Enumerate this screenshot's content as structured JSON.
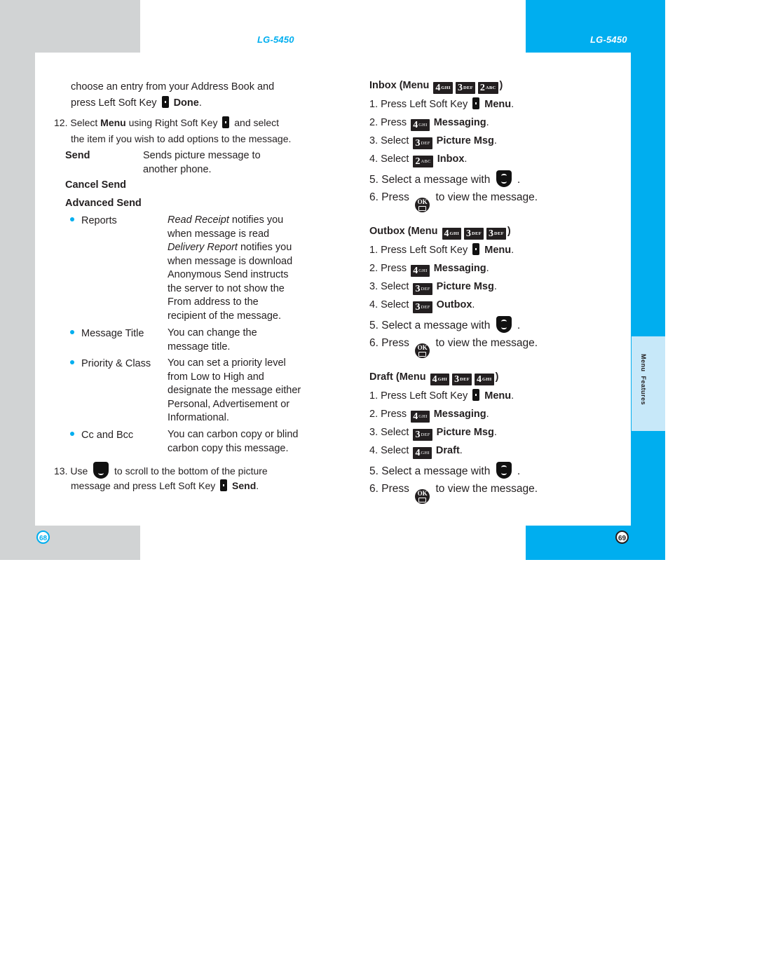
{
  "colors": {
    "accent_blue": "#00aeef",
    "light_blue": "#c7e8f9",
    "gray_frame": "#d1d3d4",
    "text": "#231f20"
  },
  "left_page": {
    "model": "LG-5450",
    "page_number": "68",
    "intro": {
      "line1": "choose an entry from your Address Book and",
      "line2_pre": "press Left Soft Key",
      "line2_bold": "Done",
      "line2_post": "."
    },
    "step12": {
      "num": "12. Select",
      "bold": "Menu",
      "mid": "using Right Soft Key",
      "end": "and select",
      "line2": "the item if you wish to add options to the message."
    },
    "options": [
      {
        "label": "Send",
        "desc_line1": "Sends picture message to",
        "desc_line2": "another phone."
      },
      {
        "label": "Cancel Send"
      },
      {
        "label": "Advanced Send"
      }
    ],
    "advanced_items": [
      {
        "label": "Reports",
        "lines": [
          {
            "italic": "Read Receipt",
            "text": " notifies you"
          },
          {
            "text": "when message is read"
          },
          {
            "italic": "Delivery Report",
            "text": " notifies you"
          },
          {
            "text": "when message is download"
          },
          {
            "text": "Anonymous Send instructs"
          },
          {
            "text": "the server to not show the"
          },
          {
            "text": "From address to the"
          },
          {
            "text": "recipient of the message."
          }
        ]
      },
      {
        "label": "Message Title",
        "lines": [
          {
            "text": "You can change the"
          },
          {
            "text": "message title."
          }
        ]
      },
      {
        "label": "Priority & Class",
        "lines": [
          {
            "text": "You can set a priority level"
          },
          {
            "text": "from Low to High and"
          },
          {
            "text": "designate the message either"
          },
          {
            "text": "Personal, Advertisement or"
          },
          {
            "text": "Informational."
          }
        ]
      },
      {
        "label": "Cc and Bcc",
        "lines": [
          {
            "text": "You can carbon copy or blind"
          },
          {
            "text": "carbon copy this message."
          }
        ]
      }
    ],
    "step13": {
      "num": "13. Use",
      "mid": "to scroll to the bottom of the picture",
      "line2_pre": "message and press Left Soft Key",
      "line2_bold": "Send",
      "line2_post": "."
    }
  },
  "right_page": {
    "model": "LG-5450",
    "page_number": "69",
    "side_tab": {
      "first": "Menu",
      "second": "Features"
    },
    "sections": [
      {
        "title": "Inbox (Menu",
        "keys": [
          {
            "n": "4",
            "l": "GHI"
          },
          {
            "n": "3",
            "l": "DEF"
          },
          {
            "n": "2",
            "l": "ABC"
          }
        ],
        "steps": [
          {
            "pre": "1. Press Left Soft Key",
            "icon": "softkey",
            "bold": "Menu",
            "post": "."
          },
          {
            "pre": "2. Press",
            "key": {
              "n": "4",
              "l": "GHI"
            },
            "bold": "Messaging",
            "post": "."
          },
          {
            "pre": "3. Select",
            "key": {
              "n": "3",
              "l": "DEF"
            },
            "bold": "Picture Msg",
            "post": "."
          },
          {
            "pre": "4. Select",
            "key": {
              "n": "2",
              "l": "ABC"
            },
            "bold": "Inbox",
            "post": "."
          },
          {
            "pre": "5. Select a message with",
            "icon": "nav",
            "post": "."
          },
          {
            "pre": "6. Press",
            "icon": "ok",
            "post": "to view the message."
          }
        ]
      },
      {
        "title": "Outbox (Menu",
        "keys": [
          {
            "n": "4",
            "l": "GHI"
          },
          {
            "n": "3",
            "l": "DEF"
          },
          {
            "n": "3",
            "l": "DEF"
          }
        ],
        "steps": [
          {
            "pre": "1. Press Left Soft Key",
            "icon": "softkey",
            "bold": "Menu",
            "post": "."
          },
          {
            "pre": "2. Press",
            "key": {
              "n": "4",
              "l": "GHI"
            },
            "bold": "Messaging",
            "post": "."
          },
          {
            "pre": "3. Select",
            "key": {
              "n": "3",
              "l": "DEF"
            },
            "bold": "Picture Msg",
            "post": "."
          },
          {
            "pre": "4. Select",
            "key": {
              "n": "3",
              "l": "DEF"
            },
            "bold": "Outbox",
            "post": "."
          },
          {
            "pre": "5. Select a message with",
            "icon": "nav",
            "post": "."
          },
          {
            "pre": "6. Press",
            "icon": "ok",
            "post": "to view the message."
          }
        ]
      },
      {
        "title": "Draft (Menu",
        "keys": [
          {
            "n": "4",
            "l": "GHI"
          },
          {
            "n": "3",
            "l": "DEF"
          },
          {
            "n": "4",
            "l": "GHI"
          }
        ],
        "steps": [
          {
            "pre": "1. Press Left Soft Key",
            "icon": "softkey",
            "bold": "Menu",
            "post": "."
          },
          {
            "pre": "2. Press",
            "key": {
              "n": "4",
              "l": "GHI"
            },
            "bold": "Messaging",
            "post": "."
          },
          {
            "pre": "3. Select",
            "key": {
              "n": "3",
              "l": "DEF"
            },
            "bold": "Picture Msg",
            "post": "."
          },
          {
            "pre": "4. Select",
            "key": {
              "n": "4",
              "l": "GHI"
            },
            "bold": "Draft",
            "post": "."
          },
          {
            "pre": "5. Select a message with",
            "icon": "nav",
            "post": "."
          },
          {
            "pre": "6. Press",
            "icon": "ok",
            "post": "to view the message."
          }
        ]
      }
    ]
  }
}
